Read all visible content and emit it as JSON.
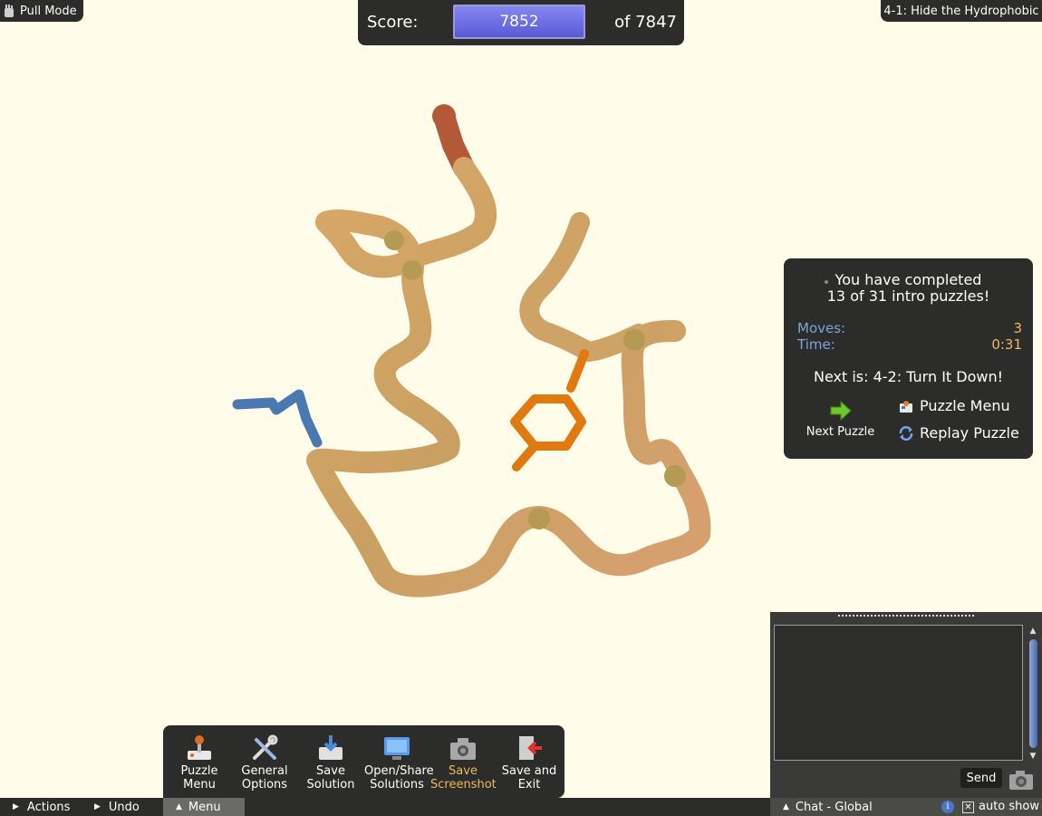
{
  "pull_mode": {
    "label": "Pull Mode"
  },
  "score": {
    "label": "Score:",
    "value": "7852",
    "target": "of 7847"
  },
  "puzzle_title": "4-1: Hide the Hydrophobic",
  "completion": {
    "line1": "You have completed",
    "line2": "13 of 31 intro puzzles!",
    "moves_label": "Moves:",
    "moves_value": "3",
    "time_label": "Time:",
    "time_value": "0:31",
    "next_is": "Next is: 4-2: Turn It Down!",
    "next_puzzle": "Next Puzzle",
    "puzzle_menu": "Puzzle Menu",
    "replay_puzzle": "Replay Puzzle"
  },
  "menu_tray": [
    {
      "line1": "Puzzle",
      "line2": "Menu",
      "icon": "joystick-icon"
    },
    {
      "line1": "General",
      "line2": "Options",
      "icon": "tools-icon"
    },
    {
      "line1": "Save",
      "line2": "Solution",
      "icon": "save-solution-icon"
    },
    {
      "line1": "Open/Share",
      "line2": "Solutions",
      "icon": "monitor-icon"
    },
    {
      "line1": "Save",
      "line2": "Screenshot",
      "icon": "camera-icon"
    },
    {
      "line1": "Save and",
      "line2": "Exit",
      "icon": "exit-door-icon"
    }
  ],
  "bottom_bar": {
    "actions": "Actions",
    "undo": "Undo",
    "menu": "Menu",
    "chat": "Chat - Global",
    "auto_show": "auto show"
  },
  "chat": {
    "send": "Send"
  },
  "colors": {
    "background": "#fffdea",
    "panel": "#2c2c2a",
    "score_fill": "#7070e8",
    "accent_orange": "#f0b860",
    "stat_blue": "#7aa6e0",
    "backbone": "#d2a060",
    "hydrophobic_sidechain": "#e07a10",
    "hydrophilic_sidechain": "#4a78b0"
  }
}
